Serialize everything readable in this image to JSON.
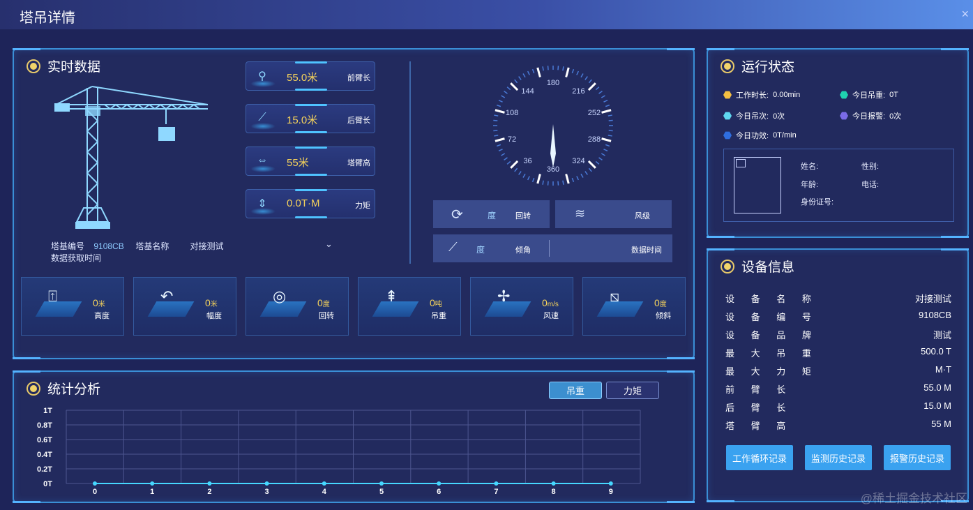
{
  "window": {
    "title": "塔吊详情",
    "close_glyph": "×"
  },
  "realtime": {
    "title": "实时数据",
    "metrics": [
      {
        "icon": "hook-icon",
        "value": "55.0米",
        "label": "前臂长"
      },
      {
        "icon": "angle-icon",
        "value": "15.0米",
        "label": "后臂长"
      },
      {
        "icon": "width-icon",
        "value": "55米",
        "label": "塔臂高"
      },
      {
        "icon": "height-icon",
        "value": "0.0T·M",
        "label": "力矩"
      }
    ],
    "base_no_label": "塔基编号",
    "base_no_value": "9108CB",
    "base_name_label": "塔基名称",
    "base_name_value": "对接测试",
    "fetch_time_label": "数据获取时间",
    "tiles": [
      {
        "value": "0",
        "unit": "米",
        "label": "高度"
      },
      {
        "value": "0",
        "unit": "米",
        "label": "幅度"
      },
      {
        "value": "0",
        "unit": "度",
        "label": "回转"
      },
      {
        "value": "0",
        "unit": "吨",
        "label": "吊重"
      },
      {
        "value": "0",
        "unit": "m/s",
        "label": "风速"
      },
      {
        "value": "0",
        "unit": "度",
        "label": "倾斜"
      }
    ],
    "compass_ticks": [
      "180",
      "216",
      "252",
      "288",
      "324",
      "360",
      "36",
      "72",
      "108",
      "144"
    ],
    "rotate": {
      "unit": "度",
      "label": "回转"
    },
    "wind": {
      "label": "风级"
    },
    "tilt": {
      "unit": "度",
      "label": "倾角"
    },
    "data_time_label": "数据时间"
  },
  "status": {
    "title": "运行状态",
    "items": [
      {
        "label": "工作时长:",
        "value": "0.00min",
        "color": "#f5c042"
      },
      {
        "label": "今日吊重:",
        "value": "0T",
        "color": "#1fd3b0"
      },
      {
        "label": "今日吊次:",
        "value": "0次",
        "color": "#5fd8f0"
      },
      {
        "label": "今日报警:",
        "value": "0次",
        "color": "#7a6be8"
      },
      {
        "label": "今日功效:",
        "value": "0T/min",
        "color": "#2f6ee0"
      }
    ],
    "person": {
      "name_label": "姓名:",
      "gender_label": "性别:",
      "age_label": "年龄:",
      "phone_label": "电话:",
      "id_label": "身份证号:"
    }
  },
  "device": {
    "title": "设备信息",
    "rows": [
      {
        "key": "设 备 名 称",
        "value": "对接测试"
      },
      {
        "key": "设 备 编 号",
        "value": "9108CB"
      },
      {
        "key": "设 备 品 牌",
        "value": "测试"
      },
      {
        "key": "最 大 吊 重",
        "value": "500.0 T"
      },
      {
        "key": "最 大 力 矩",
        "value": "M·T"
      },
      {
        "key": "前  臂  长",
        "value": "55.0 M"
      },
      {
        "key": "后  臂  长",
        "value": "15.0 M"
      },
      {
        "key": "塔  臂  高",
        "value": "55 M"
      }
    ],
    "buttons": [
      "工作循环记录",
      "监测历史记录",
      "报警历史记录"
    ]
  },
  "stats": {
    "title": "统计分析",
    "tabs": [
      "吊重",
      "力矩"
    ],
    "active_tab": "吊重"
  },
  "chart_data": {
    "type": "line",
    "x": [
      0,
      1,
      2,
      3,
      4,
      5,
      6,
      7,
      8,
      9
    ],
    "y_ticks": [
      "0T",
      "0.2T",
      "0.4T",
      "0.6T",
      "0.8T",
      "1T"
    ],
    "ylim": [
      0,
      1
    ],
    "series": [
      {
        "values": [
          0,
          0,
          0,
          0,
          0,
          0,
          0,
          0,
          0,
          0
        ]
      }
    ],
    "grid": true,
    "color": "#46d7ff"
  },
  "watermark": "@稀土掘金技术社区"
}
